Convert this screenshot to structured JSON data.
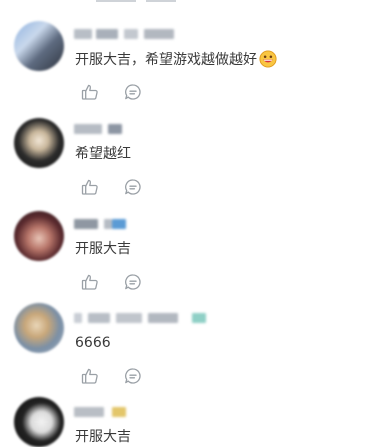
{
  "comments": [
    {
      "text": "开服大吉，希望游戏越做越好",
      "has_emoji": true,
      "emoji_icon": "grinning-face-emoji"
    },
    {
      "text": "希望越红"
    },
    {
      "text": "开服大吉"
    },
    {
      "text": "6666"
    },
    {
      "text": "开服大吉"
    }
  ],
  "icons": {
    "like": "thumbs-up-icon",
    "reply": "comment-bubble-icon"
  },
  "colors": {
    "icon_stroke": "#9aa0a6",
    "text": "#3a3a3a",
    "background": "#ffffff"
  }
}
